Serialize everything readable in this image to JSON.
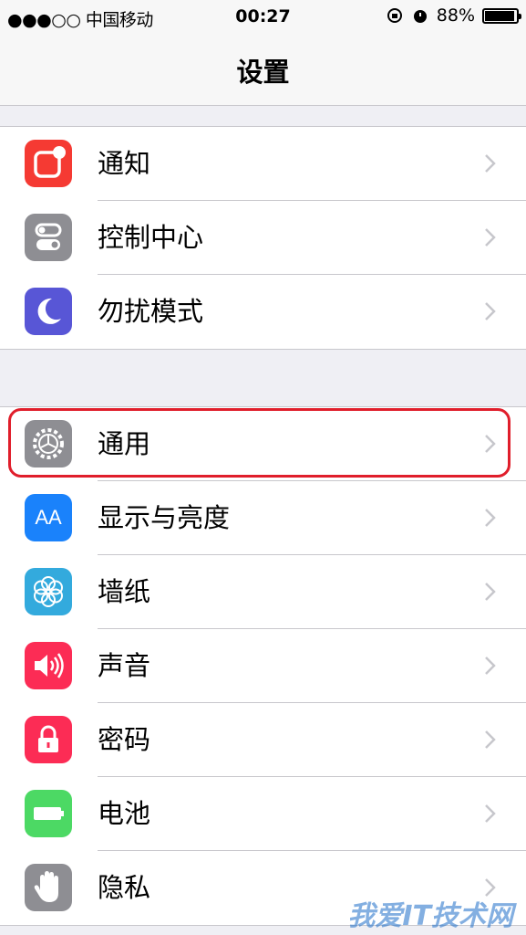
{
  "status_bar": {
    "carrier": "●●●○○ 中国移动",
    "time": "00:27",
    "battery": "88%"
  },
  "nav": {
    "title": "设置"
  },
  "groups": [
    {
      "items": [
        {
          "label": "通知",
          "icon": "notifications-icon",
          "color": "#f53a33"
        },
        {
          "label": "控制中心",
          "icon": "control-center-icon",
          "color": "#8e8e93"
        },
        {
          "label": "勿扰模式",
          "icon": "moon-icon",
          "color": "#5856d6"
        }
      ]
    },
    {
      "items": [
        {
          "label": "通用",
          "icon": "gear-icon",
          "color": "#8e8e93"
        },
        {
          "label": "显示与亮度",
          "icon": "display-icon",
          "icon_text": "AA",
          "color": "#1a82fb"
        },
        {
          "label": "墙纸",
          "icon": "wallpaper-icon",
          "color": "#33aadd"
        },
        {
          "label": "声音",
          "icon": "speaker-icon",
          "color": "#fc2c55"
        },
        {
          "label": "密码",
          "icon": "lock-icon",
          "color": "#fc2c55"
        },
        {
          "label": "电池",
          "icon": "battery-icon",
          "color": "#4cd964"
        },
        {
          "label": "隐私",
          "icon": "hand-icon",
          "color": "#8e8e93"
        }
      ]
    }
  ],
  "watermark": "我爱IT技术网"
}
